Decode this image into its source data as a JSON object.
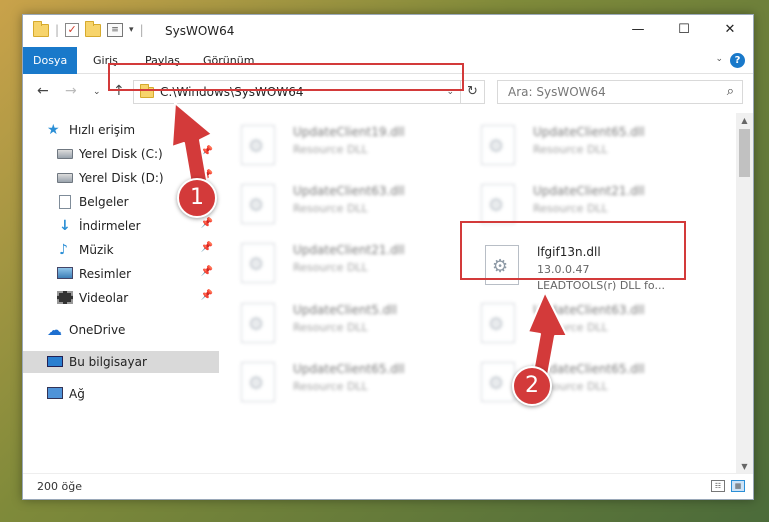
{
  "window": {
    "title": "SysWOW64",
    "min_glyph": "—",
    "max_glyph": "☐",
    "close_glyph": "✕"
  },
  "quick_access_toolbar": {
    "separator": "|",
    "dropdown_glyph": "▾",
    "check_glyph": "✓",
    "props_glyph": "≡"
  },
  "ribbon": {
    "tabs": [
      {
        "label": "Dosya",
        "active": true
      },
      {
        "label": "Giriş"
      },
      {
        "label": "Paylaş"
      },
      {
        "label": "Görünüm"
      }
    ],
    "expand_glyph": "⌄",
    "help_label": "?"
  },
  "navigation": {
    "back_glyph": "←",
    "forward_glyph": "→",
    "recent_glyph": "⌄",
    "up_glyph": "↑",
    "address": "C:\\Windows\\SysWOW64",
    "address_dd_glyph": "⌄",
    "refresh_glyph": "↻",
    "search_placeholder": "Ara: SysWOW64",
    "search_glyph": "⌕"
  },
  "sidebar": {
    "pin_glyph": "📌",
    "items": [
      {
        "label": "Hızlı erişim",
        "icon": "star-icon",
        "glyph": "★"
      },
      {
        "label": "Yerel Disk (C:)",
        "icon": "drive-icon",
        "pinned": true
      },
      {
        "label": "Yerel Disk (D:)",
        "icon": "drive-icon",
        "pinned": true
      },
      {
        "label": "Belgeler",
        "icon": "document-icon",
        "pinned": true
      },
      {
        "label": "İndirmeler",
        "icon": "download-icon",
        "glyph": "↓",
        "pinned": true
      },
      {
        "label": "Müzik",
        "icon": "music-icon",
        "glyph": "♪",
        "pinned": true
      },
      {
        "label": "Resimler",
        "icon": "picture-icon",
        "pinned": true
      },
      {
        "label": "Videolar",
        "icon": "film-icon",
        "pinned": true
      },
      {
        "label": "OneDrive",
        "icon": "cloud-icon",
        "glyph": "☁"
      },
      {
        "label": "Bu bilgisayar",
        "icon": "computer-icon",
        "selected": true
      },
      {
        "label": "Ağ",
        "icon": "network-icon"
      }
    ]
  },
  "files": [
    {
      "name": "UpdateClient19.dll",
      "desc": "Resource DLL"
    },
    {
      "name": "UpdateClient65.dll",
      "desc": "Resource DLL"
    },
    {
      "name": "UpdateClient63.dll",
      "desc": "Resource DLL"
    },
    {
      "name": "UpdateClient21.dll",
      "desc": "Resource DLL"
    },
    {
      "name": "UpdateClient21.dll",
      "desc": "Resource DLL"
    },
    {
      "name": "lfgif13n.dll",
      "desc": "13.0.0.47",
      "sub": "LEADTOOLS(r) DLL fo...",
      "highlighted": true
    },
    {
      "name": "UpdateClient5.dll",
      "desc": "Resource DLL"
    },
    {
      "name": "UpdateClient63.dll",
      "desc": "Resource DLL"
    },
    {
      "name": "UpdateClient65.dll",
      "desc": "Resource DLL"
    },
    {
      "name": "UpdateClient65.dll",
      "desc": "Resource DLL"
    }
  ],
  "scrollbar": {
    "up_glyph": "▲",
    "down_glyph": "▼"
  },
  "status": {
    "item_count": "200 öğe",
    "details_glyph": "☷",
    "tiles_glyph": "▦"
  },
  "callouts": {
    "step1": "1",
    "step2": "2"
  },
  "colors": {
    "accent": "#1979ca",
    "highlight": "#d33a3a"
  }
}
